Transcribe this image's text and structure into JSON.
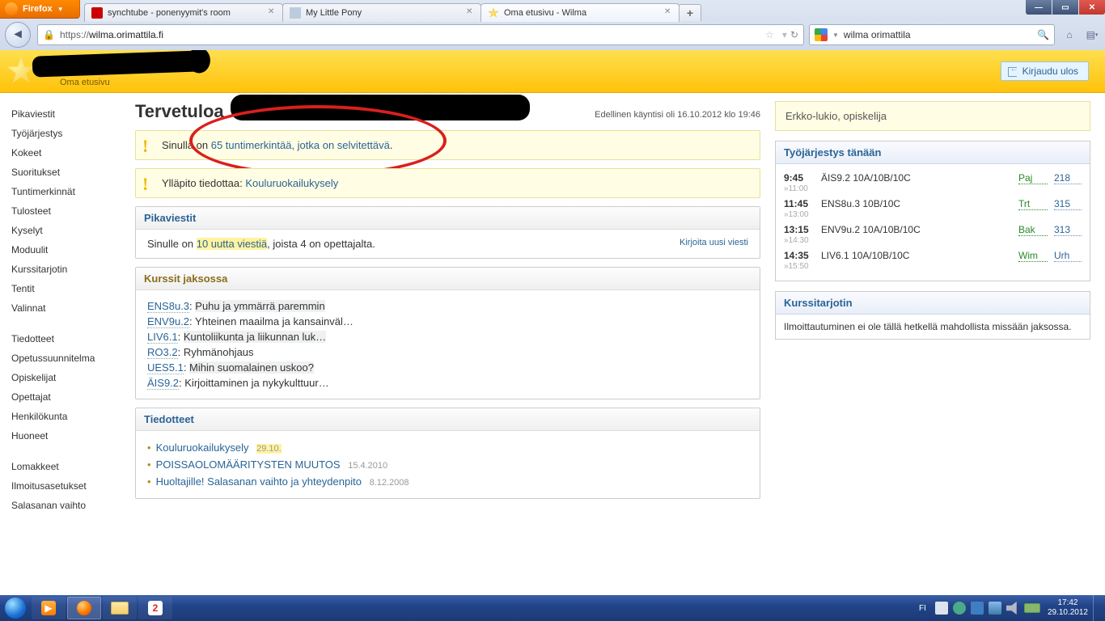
{
  "browser": {
    "name": "Firefox",
    "tabs": [
      {
        "title": "synchtube - ponenyymit's room"
      },
      {
        "title": "My Little Pony"
      },
      {
        "title": "Oma etusivu - Wilma"
      }
    ],
    "url_prefix": "https://",
    "url_host": "wilma.orimattila.fi",
    "search_value": "wilma orimattila"
  },
  "header": {
    "subtitle": "Oma etusivu",
    "logout": "Kirjaudu ulos"
  },
  "welcome": {
    "title": "Tervetuloa",
    "last_login": "Edellinen käyntisi oli 16.10.2012 klo 19:46"
  },
  "alerts": {
    "a1_pre": "Sinulla on ",
    "a1_link": "65 tuntimerkintää, jotka on selvitettävä",
    "a1_post": ".",
    "a2_pre": "Ylläpito tiedottaa: ",
    "a2_link": "Kouluruokailukysely"
  },
  "pika": {
    "title": "Pikaviestit",
    "line_pre": "Sinulle on ",
    "line_link": "10 uutta viestiä",
    "line_post": ", joista 4 on opettajalta.",
    "write": "Kirjoita uusi viesti"
  },
  "courses": {
    "title": "Kurssit jaksossa",
    "items": [
      {
        "code": "ENS8u.3",
        "name": "Puhu ja ymmärrä paremmin",
        "hl": true
      },
      {
        "code": "ENV9u.2",
        "name": "Yhteinen maailma ja kansainväl…",
        "hl": false
      },
      {
        "code": "LIV6.1",
        "name": "Kuntoliikunta ja liikunnan luk…",
        "hl": true
      },
      {
        "code": "RO3.2",
        "name": "Ryhmänohjaus",
        "hl": false
      },
      {
        "code": "UES5.1",
        "name": "Mihin suomalainen uskoo?",
        "hl": true
      },
      {
        "code": "ÄIS9.2",
        "name": "Kirjoittaminen ja nykykulttuur…",
        "hl": false
      }
    ]
  },
  "news": {
    "title": "Tiedotteet",
    "items": [
      {
        "title": "Kouluruokailukysely",
        "date": "29.10.",
        "hl": true
      },
      {
        "title": "POISSAOLOMÄÄRITYSTEN MUUTOS",
        "date": "15.4.2010",
        "hl": false
      },
      {
        "title": "Huoltajille! Salasanan vaihto ja yhteydenpito",
        "date": "8.12.2008",
        "hl": false
      }
    ]
  },
  "rightinfo": "Erkko-lukio, opiskelija",
  "schedule": {
    "title": "Työjärjestys tänään",
    "rows": [
      {
        "start": "9:45",
        "end": "11:00",
        "subject": "ÄIS9.2 10A/10B/10C",
        "teacher": "Paj",
        "room": "218"
      },
      {
        "start": "11:45",
        "end": "13:00",
        "subject": "ENS8u.3 10B/10C",
        "teacher": "Trt",
        "room": "315"
      },
      {
        "start": "13:15",
        "end": "14:30",
        "subject": "ENV9u.2 10A/10B/10C",
        "teacher": "Bak",
        "room": "313"
      },
      {
        "start": "14:35",
        "end": "15:50",
        "subject": "LIV6.1 10A/10B/10C",
        "teacher": "Wim",
        "room": "Urh"
      }
    ]
  },
  "tarjotin": {
    "title": "Kurssitarjotin",
    "body": "Ilmoittautuminen ei ole tällä hetkellä mahdollista missään jaksossa."
  },
  "leftnav": {
    "g1": [
      "Pikaviestit",
      "Työjärjestys",
      "Kokeet",
      "Suoritukset",
      "Tuntimerkinnät",
      "Tulosteet",
      "Kyselyt",
      "Moduulit",
      "Kurssitarjotin",
      "Tentit",
      "Valinnat"
    ],
    "g2": [
      "Tiedotteet",
      "Opetussuunnitelma",
      "Opiskelijat",
      "Opettajat",
      "Henkilökunta",
      "Huoneet"
    ],
    "g3": [
      "Lomakkeet",
      "Ilmoitusasetukset",
      "Salasanan vaihto"
    ]
  },
  "taskbar": {
    "lang": "FI",
    "time": "17:42",
    "date": "29.10.2012"
  }
}
